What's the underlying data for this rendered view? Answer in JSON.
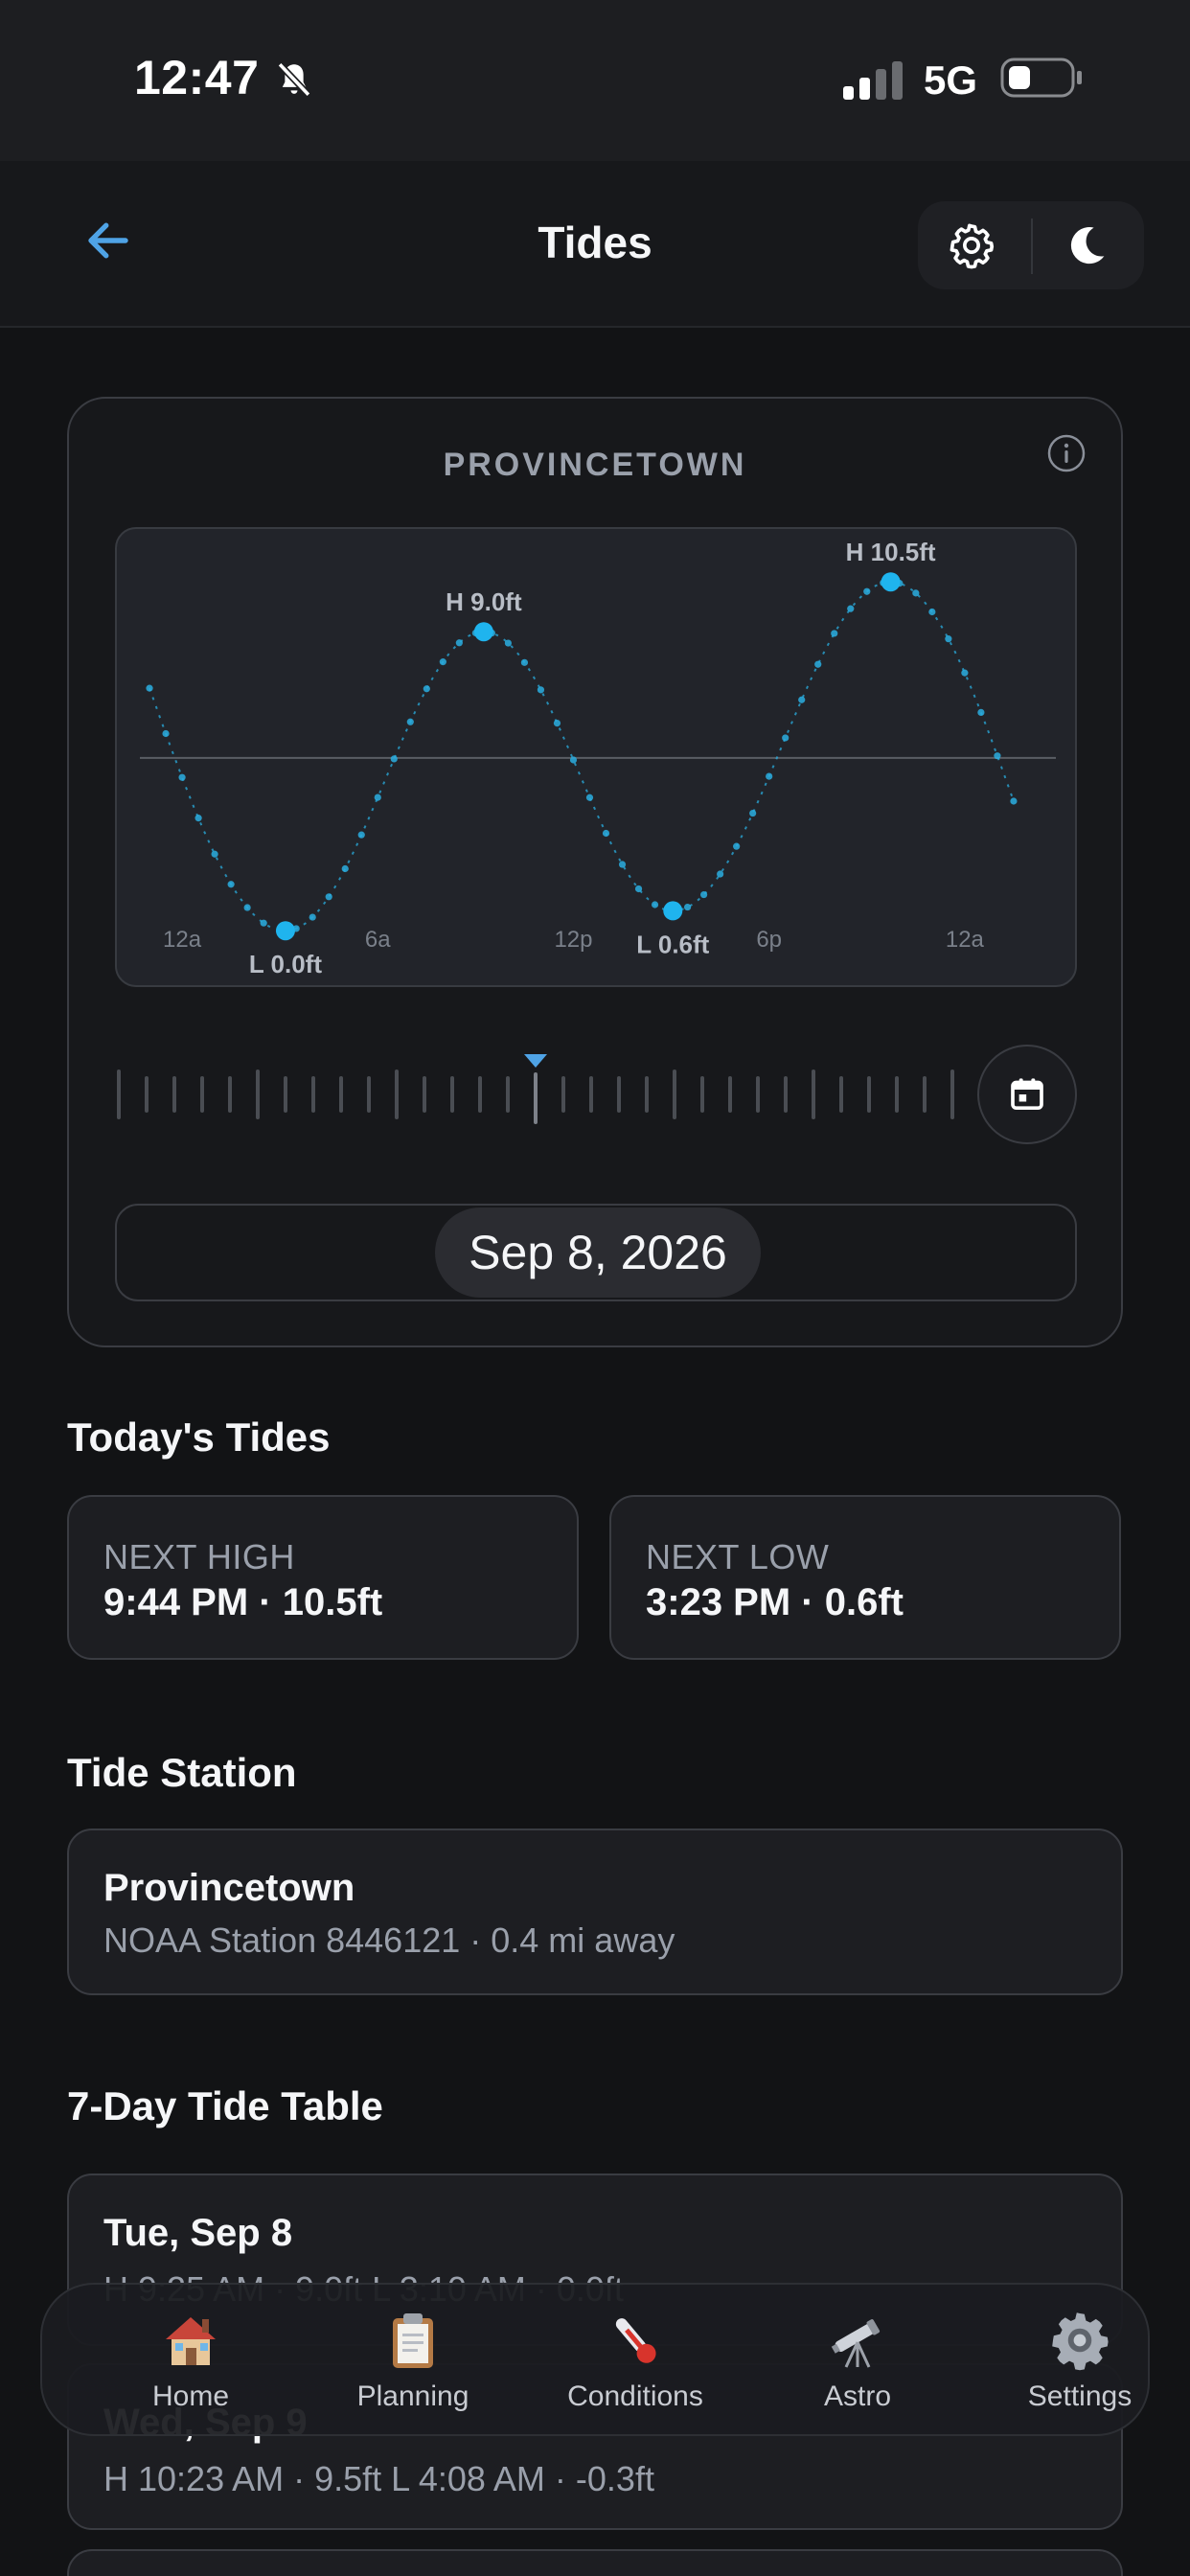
{
  "status": {
    "time": "12:47",
    "network": "5G"
  },
  "nav": {
    "title": "Tides"
  },
  "card": {
    "station": "PROVINCETOWN",
    "date": "Sep 8, 2026"
  },
  "chart_data": {
    "type": "line",
    "x_ticks": [
      {
        "h": 0,
        "label": "12a"
      },
      {
        "h": 6,
        "label": "6a"
      },
      {
        "h": 12,
        "label": "12p"
      },
      {
        "h": 18,
        "label": "6p"
      },
      {
        "h": 24,
        "label": "12a"
      }
    ],
    "xlim": [
      -2,
      27.5
    ],
    "ylim": [
      -0.6,
      11.4
    ],
    "mean_level": 5.2,
    "extremes": [
      {
        "h": 3.17,
        "v": 0.0,
        "label": "L 0.0ft"
      },
      {
        "h": 9.25,
        "v": 9.0,
        "label": "H 9.0ft"
      },
      {
        "h": 15.05,
        "v": 0.6,
        "label": "L 0.6ft"
      },
      {
        "h": 21.73,
        "v": 10.5,
        "label": "H 10.5ft"
      }
    ],
    "range": [
      -1,
      25.5
    ],
    "start_level": 7.3,
    "end_level": 3.9,
    "grid": false
  },
  "today": {
    "title": "Today's Tides",
    "high_label": "NEXT HIGH",
    "high_value": "9:44 PM · 10.5ft",
    "low_label": "NEXT LOW",
    "low_value": "3:23 PM · 0.6ft"
  },
  "station": {
    "title": "Tide Station",
    "name": "Provincetown",
    "meta": "NOAA Station 8446121 · 0.4 mi away"
  },
  "table": {
    "title": "7-Day Tide Table",
    "days": [
      {
        "day": "Tue, Sep 8",
        "tides": "H 9:25 AM · 9.0ft   L 3:10 AM · 0.0ft"
      },
      {
        "day": "Wed, Sep 9",
        "tides": "H 10:23 AM · 9.5ft   L 4:08 AM · -0.3ft"
      }
    ]
  },
  "tabs": [
    {
      "label": "Home",
      "icon": "house-icon"
    },
    {
      "label": "Planning",
      "icon": "clipboard-icon"
    },
    {
      "label": "Conditions",
      "icon": "thermometer-icon"
    },
    {
      "label": "Astro",
      "icon": "telescope-icon"
    },
    {
      "label": "Settings",
      "icon": "gear-icon"
    }
  ],
  "colors": {
    "accent": "#2aaee0",
    "background": "#121315",
    "card": "#1d1e22",
    "muted": "#9aa0ab"
  }
}
